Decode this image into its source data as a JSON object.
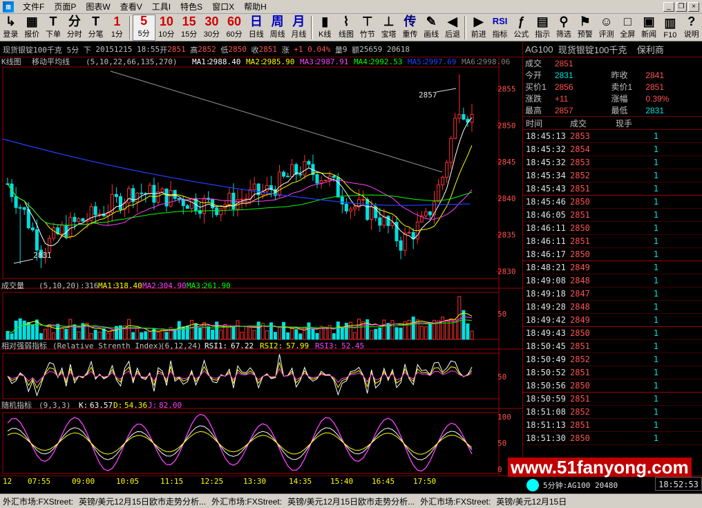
{
  "menu": {
    "items": [
      "文件F",
      "页面P",
      "图表W",
      "查看V",
      "工具I",
      "特色S",
      "窗口X",
      "帮助H"
    ]
  },
  "toolbar": {
    "buttons": [
      {
        "icon": "↳",
        "label": "登录"
      },
      {
        "icon": "▦",
        "label": "报价"
      },
      {
        "icon": "T",
        "label": "下单"
      },
      {
        "icon": "分",
        "label": "分时"
      },
      {
        "icon": "T",
        "label": "分笔"
      },
      {
        "icon": "1",
        "label": "1分"
      },
      {
        "icon": "5",
        "label": "5分"
      },
      {
        "icon": "10",
        "label": "10分"
      },
      {
        "icon": "15",
        "label": "15分"
      },
      {
        "icon": "30",
        "label": "30分"
      },
      {
        "icon": "60",
        "label": "60分"
      },
      {
        "icon": "日",
        "label": "日线"
      },
      {
        "icon": "周",
        "label": "周线"
      },
      {
        "icon": "月",
        "label": "月线"
      },
      {
        "icon": "▮",
        "label": "K线"
      },
      {
        "icon": "⌇",
        "label": "线图"
      },
      {
        "icon": "⊤",
        "label": "竹节"
      },
      {
        "icon": "⊥",
        "label": "宝塔"
      },
      {
        "icon": "传",
        "label": "重传"
      },
      {
        "icon": "✎",
        "label": "画线"
      },
      {
        "icon": "◀",
        "label": "后退"
      },
      {
        "icon": "▶",
        "label": "前进"
      },
      {
        "icon": "RSI",
        "label": "指标"
      },
      {
        "icon": "ƒ",
        "label": "公式"
      },
      {
        "icon": "▤",
        "label": "指示"
      },
      {
        "icon": "⚲",
        "label": "筛选"
      },
      {
        "icon": "⚑",
        "label": "预警"
      },
      {
        "icon": "☺",
        "label": "评测"
      },
      {
        "icon": "□",
        "label": "全屏"
      },
      {
        "icon": "▣",
        "label": "新闻"
      },
      {
        "icon": "▥",
        "label": "F10"
      },
      {
        "icon": "?",
        "label": "说明"
      }
    ]
  },
  "quote_strip": {
    "name": "现货银锭100千克",
    "period": "5分",
    "dir": "下",
    "date": "20151215",
    "time": "18:55",
    "open_label": "开",
    "open": "2851",
    "high_label": "高",
    "high": "2852",
    "low_label": "低",
    "low": "2850",
    "close_label": "收",
    "close": "2851",
    "change_label": "涨",
    "change": "+1",
    "pct": "0.04%",
    "vol_label": "量",
    "vol": "9",
    "amt_label": "额",
    "amt": "25659",
    "extra": "20618"
  },
  "main_chart": {
    "title": "K线图",
    "indicator": "移动平均线",
    "params": "(5,10,22,66,135,270)",
    "ma": [
      {
        "label": "MA1:",
        "value": "2988.40",
        "color": "#ffffff"
      },
      {
        "label": "MA2:",
        "value": "2985.90",
        "color": "#ffff00"
      },
      {
        "label": "MA3:",
        "value": "2987.91",
        "color": "#ff40ff"
      },
      {
        "label": "MA4:",
        "value": "2992.53",
        "color": "#00ff00"
      },
      {
        "label": "MA5:",
        "value": "2997.69",
        "color": "#2040ff"
      },
      {
        "label": "MA6:",
        "value": "2998.06",
        "color": "#808080"
      }
    ],
    "y_ticks": [
      "2855",
      "2850",
      "2845",
      "2840",
      "2835",
      "2830"
    ],
    "high_mark": "2857",
    "low_mark": "2831"
  },
  "volume_chart": {
    "title": "成交量",
    "params": "(5,10,20)",
    "value": ":316",
    "ma": [
      {
        "label": "MA1:",
        "value": "318.40",
        "color": "#ffff00"
      },
      {
        "label": "MA2:",
        "value": "304.90",
        "color": "#ff40ff"
      },
      {
        "label": "MA3:",
        "value": "261.90",
        "color": "#00ff00"
      }
    ],
    "y_ticks": [
      "50"
    ]
  },
  "rsi_chart": {
    "title": "相对强弱指标",
    "full": "(Relative Strenth Index)",
    "params": "(6,12,24)",
    "values": [
      {
        "label": "RSI1:",
        "value": "67.22",
        "color": "#ffffff"
      },
      {
        "label": "RSI2:",
        "value": "57.99",
        "color": "#ffff00"
      },
      {
        "label": "RSI3:",
        "value": "52.45",
        "color": "#ff40ff"
      }
    ],
    "y_ticks": [
      "50"
    ]
  },
  "kdj_chart": {
    "title": "随机指标",
    "params": "(9,3,3)",
    "values": [
      {
        "label": "K:",
        "value": "63.57",
        "color": "#ffffff"
      },
      {
        "label": "D:",
        "value": "54.36",
        "color": "#ffff00"
      },
      {
        "label": "J:",
        "value": "82.00",
        "color": "#ff40ff"
      }
    ],
    "y_ticks": [
      "100",
      "50",
      "0"
    ]
  },
  "time_axis": [
    "12",
    "07:55",
    "09:00",
    "10:05",
    "11:15",
    "12:25",
    "13:30",
    "14:35",
    "15:40",
    "16:45",
    "17:50"
  ],
  "right_panel": {
    "code": "AG100",
    "name": "现货银锭100千克",
    "broker": "保利商",
    "rows": [
      {
        "k": "成交",
        "v": "2851",
        "vc": "#ff5050",
        "k2": "",
        "v2": "",
        "v2c": ""
      },
      {
        "k": "今开",
        "v": "2831",
        "vc": "#00e0e0",
        "k2": "昨收",
        "v2": "2841",
        "v2c": "#ff5050"
      },
      {
        "k": "买价1",
        "v": "2856",
        "vc": "#ff5050",
        "k2": "卖价1",
        "v2": "2851",
        "v2c": "#ff5050"
      },
      {
        "k": "涨跌",
        "v": "+11",
        "vc": "#ff5050",
        "k2": "涨幅",
        "v2": "0.39%",
        "v2c": "#ff5050"
      },
      {
        "k": "最高",
        "v": "2857",
        "vc": "#ff5050",
        "k2": "最低",
        "v2": "2831",
        "v2c": "#00e0e0"
      }
    ],
    "tick_headers": [
      "时间",
      "成交",
      "现手"
    ],
    "ticks": [
      {
        "t": "18:45:13",
        "p": "2853",
        "q": "1"
      },
      {
        "t": "18:45:32",
        "p": "2854",
        "q": "1"
      },
      {
        "t": "18:45:32",
        "p": "2853",
        "q": "1"
      },
      {
        "t": "18:45:34",
        "p": "2852",
        "q": "1"
      },
      {
        "t": "18:45:43",
        "p": "2851",
        "q": "1"
      },
      {
        "t": "18:45:46",
        "p": "2850",
        "q": "1"
      },
      {
        "t": "18:46:05",
        "p": "2851",
        "q": "1"
      },
      {
        "t": "18:46:11",
        "p": "2850",
        "q": "1"
      },
      {
        "t": "18:46:11",
        "p": "2851",
        "q": "1"
      },
      {
        "t": "18:46:17",
        "p": "2850",
        "q": "1"
      },
      {
        "t": "18:48:21",
        "p": "2849",
        "q": "1"
      },
      {
        "t": "18:49:08",
        "p": "2848",
        "q": "1"
      },
      {
        "t": "18:49:18",
        "p": "2847",
        "q": "1"
      },
      {
        "t": "18:49:28",
        "p": "2848",
        "q": "1"
      },
      {
        "t": "18:49:42",
        "p": "2849",
        "q": "1"
      },
      {
        "t": "18:49:43",
        "p": "2850",
        "q": "1"
      },
      {
        "t": "18:50:45",
        "p": "2851",
        "q": "1"
      },
      {
        "t": "18:50:49",
        "p": "2852",
        "q": "1"
      },
      {
        "t": "18:50:52",
        "p": "2851",
        "q": "1"
      },
      {
        "t": "18:50:56",
        "p": "2850",
        "q": "1"
      },
      {
        "t": "18:50:59",
        "p": "2851",
        "q": "1"
      },
      {
        "t": "18:51:08",
        "p": "2852",
        "q": "1"
      },
      {
        "t": "18:51:13",
        "p": "2851",
        "q": "1"
      },
      {
        "t": "18:51:30",
        "p": "2850",
        "q": "1"
      }
    ]
  },
  "status": {
    "mini_label": "5分钟:AG100",
    "mini_value": "20480",
    "clock": "18:52:53",
    "watermark": "www.51fanyong.com"
  },
  "ticker": {
    "items": [
      "外汇市场:FXStreet:",
      "英镑/美元12月15日欧市走势分析...",
      "外汇市场:FXStreet:",
      "英镑/美元12月15日欧市走势分析...",
      "外汇市场:FXStreet:",
      "英镑/美元12月15日"
    ]
  },
  "colors": {
    "up": "#ff5050",
    "down": "#00e0e0",
    "frame": "#800000"
  }
}
